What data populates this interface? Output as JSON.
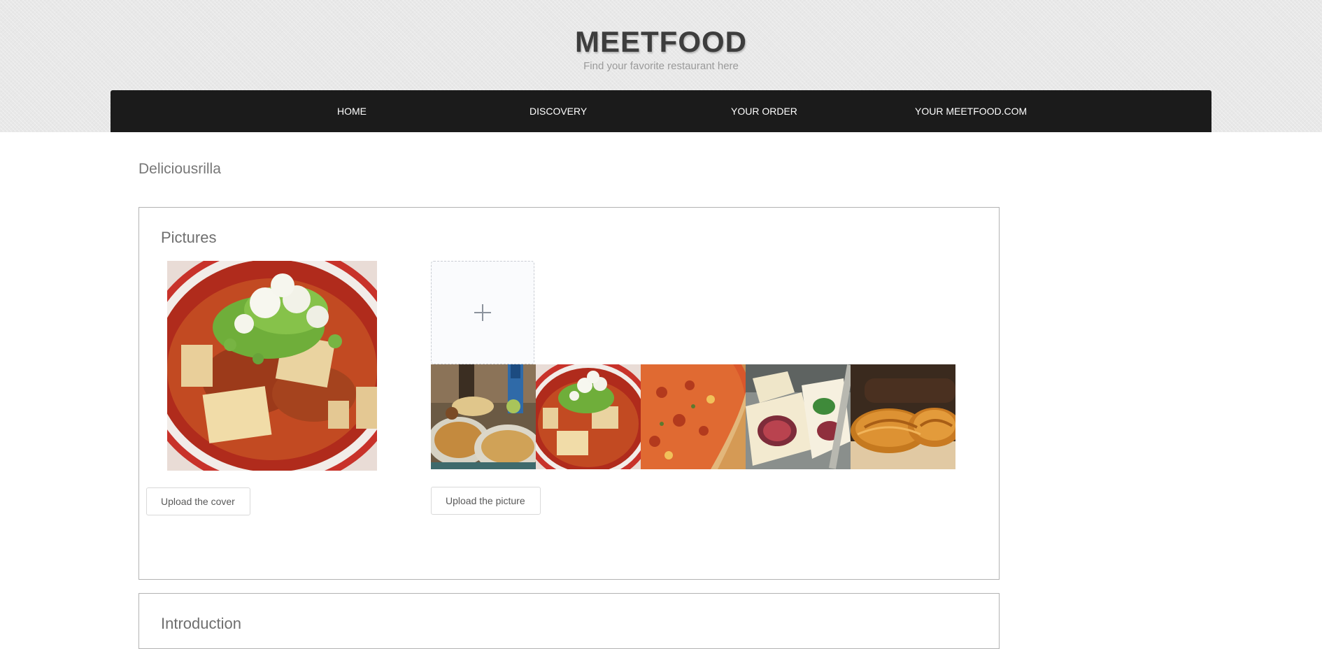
{
  "header": {
    "brand": "MEETFOOD",
    "tagline": "Find your favorite restaurant here"
  },
  "nav": {
    "items": [
      {
        "label": "HOME"
      },
      {
        "label": "DISCOVERY"
      },
      {
        "label": "YOUR ORDER"
      },
      {
        "label": "YOUR MEETFOOD.COM"
      }
    ]
  },
  "restaurant": {
    "name": "Deliciousrilla"
  },
  "pictures": {
    "title": "Pictures",
    "cover_button": "Upload the cover",
    "picture_button": "Upload the picture",
    "cover_image": "mapo-tofu-soup-image",
    "thumbnails": [
      {
        "image": "tacos-and-drinks-image"
      },
      {
        "image": "mapo-tofu-soup-image"
      },
      {
        "image": "pizza-image"
      },
      {
        "image": "fig-sandwich-image"
      },
      {
        "image": "croissants-image"
      }
    ]
  },
  "introduction": {
    "title": "Introduction"
  },
  "colors": {
    "nav_background": "#1b1b1b",
    "header_background": "#e8e8e8",
    "brand_text": "#3d3d3d"
  }
}
